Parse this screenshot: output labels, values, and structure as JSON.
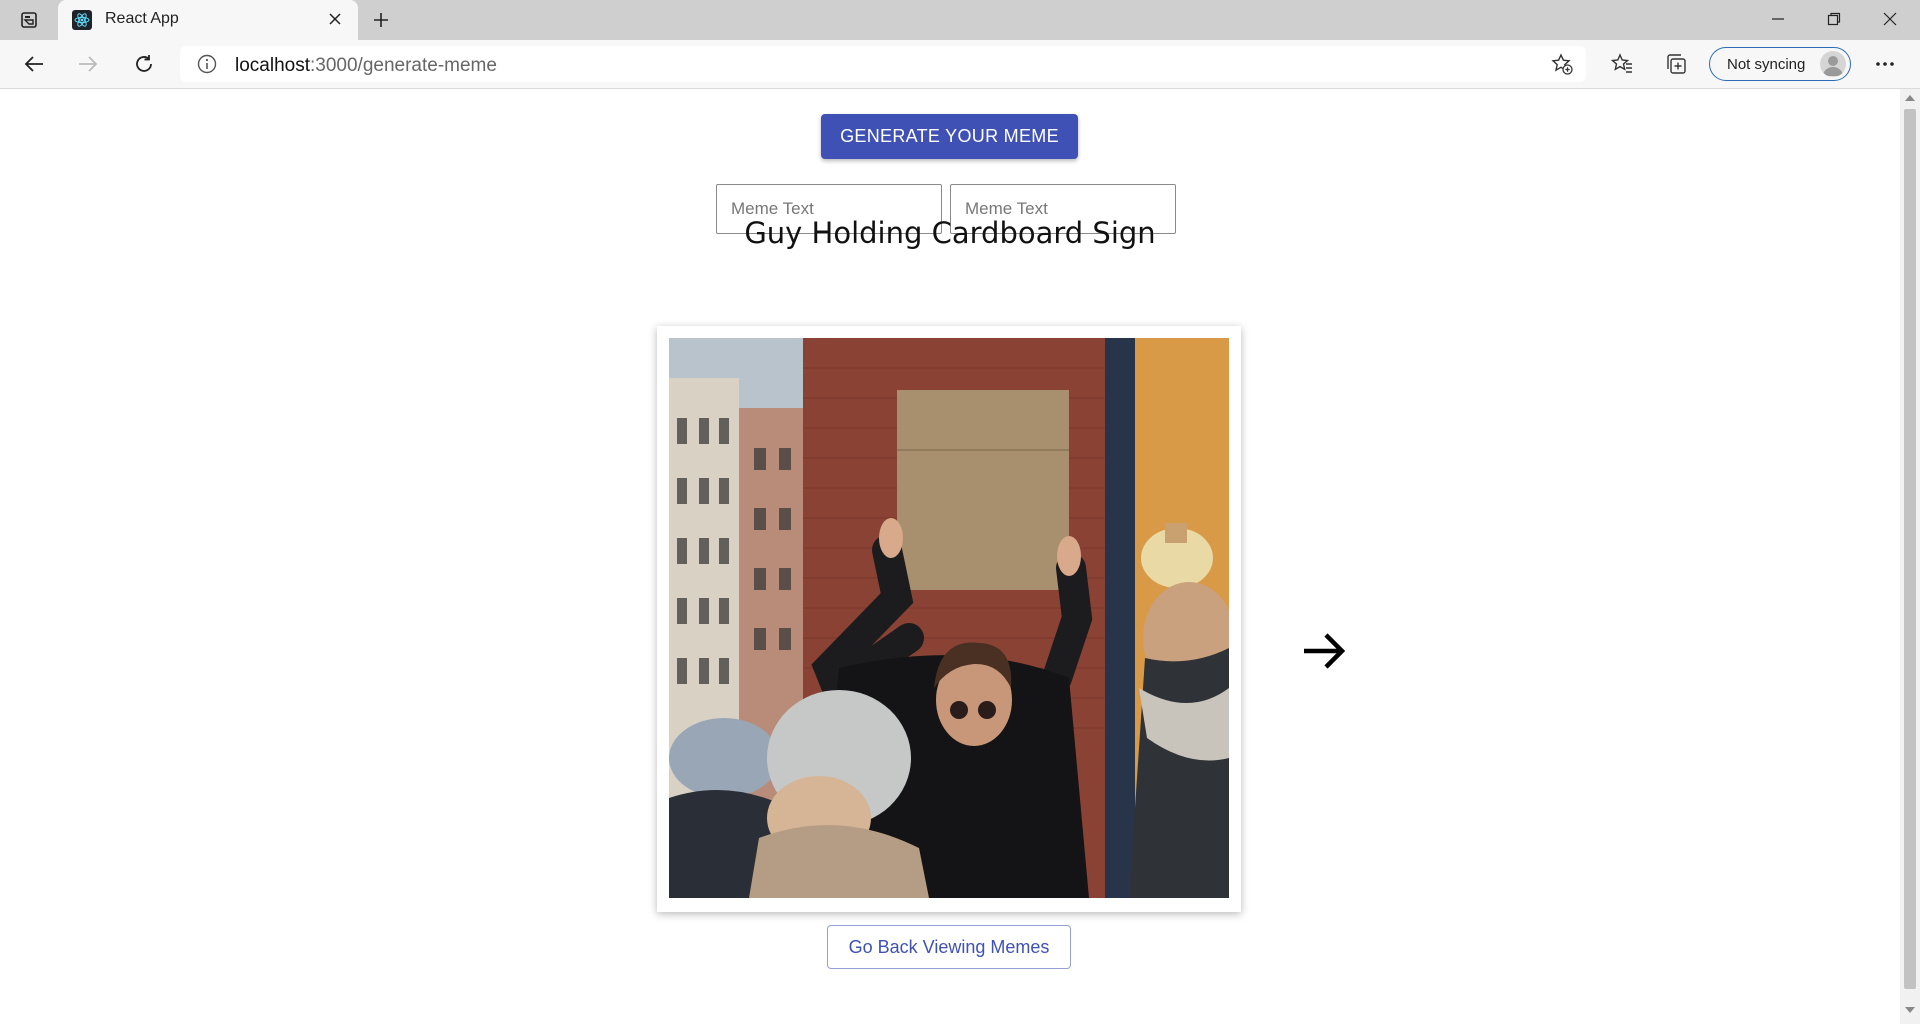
{
  "browser": {
    "tab": {
      "title": "React App",
      "favicon": "react-icon"
    },
    "address": {
      "host": "localhost",
      "path": ":3000/generate-meme"
    },
    "sync_label": "Not syncing",
    "icons": [
      "tab-actions-icon",
      "close-icon",
      "plus-icon",
      "minimize-icon",
      "restore-icon",
      "window-close-icon",
      "back-arrow-icon",
      "forward-arrow-icon",
      "refresh-icon",
      "info-icon",
      "add-favorite-icon",
      "favorites-icon",
      "collections-icon",
      "profile-avatar-icon",
      "more-icon"
    ]
  },
  "page": {
    "generate_button": "Generate your meme",
    "inputs": [
      {
        "placeholder": "Meme Text",
        "value": ""
      },
      {
        "placeholder": "Meme Text",
        "value": ""
      }
    ],
    "meme_title": "Guy Holding Cardboard Sign",
    "next_icon": "arrow-right-icon",
    "back_button": "Go Back Viewing Memes"
  }
}
